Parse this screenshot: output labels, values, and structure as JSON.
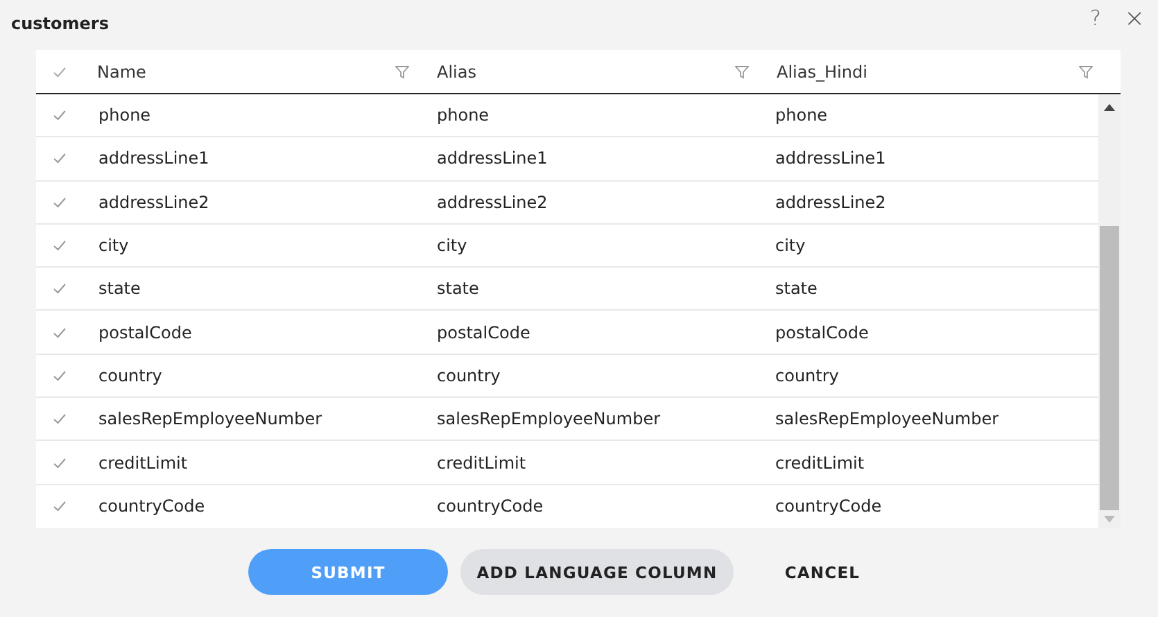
{
  "window": {
    "title": "customers",
    "help": "?",
    "close": "×"
  },
  "table": {
    "select_all_checked": true,
    "columns": [
      {
        "label": "Name",
        "filter": true
      },
      {
        "label": "Alias",
        "filter": true
      },
      {
        "label": "Alias_Hindi",
        "filter": true
      }
    ],
    "rows": [
      {
        "checked": true,
        "cells": [
          "phone",
          "phone",
          "phone"
        ]
      },
      {
        "checked": true,
        "cells": [
          "addressLine1",
          "addressLine1",
          "addressLine1"
        ]
      },
      {
        "checked": true,
        "cells": [
          "addressLine2",
          "addressLine2",
          "addressLine2"
        ]
      },
      {
        "checked": true,
        "cells": [
          "city",
          "city",
          "city"
        ]
      },
      {
        "checked": true,
        "cells": [
          "state",
          "state",
          "state"
        ]
      },
      {
        "checked": true,
        "cells": [
          "postalCode",
          "postalCode",
          "postalCode"
        ]
      },
      {
        "checked": true,
        "cells": [
          "country",
          "country",
          "country"
        ]
      },
      {
        "checked": true,
        "cells": [
          "salesRepEmployeeNumber",
          "salesRepEmployeeNumber",
          "salesRepEmployeeNumber"
        ]
      },
      {
        "checked": true,
        "cells": [
          "creditLimit",
          "creditLimit",
          "creditLimit"
        ]
      },
      {
        "checked": true,
        "cells": [
          "countryCode",
          "countryCode",
          "countryCode"
        ]
      }
    ]
  },
  "buttons": [
    {
      "label": "SUBMIT",
      "kind": "primary"
    },
    {
      "label": "ADD LANGUAGE COLUMN",
      "kind": "secondary"
    },
    {
      "label": "CANCEL",
      "kind": "text"
    }
  ]
}
